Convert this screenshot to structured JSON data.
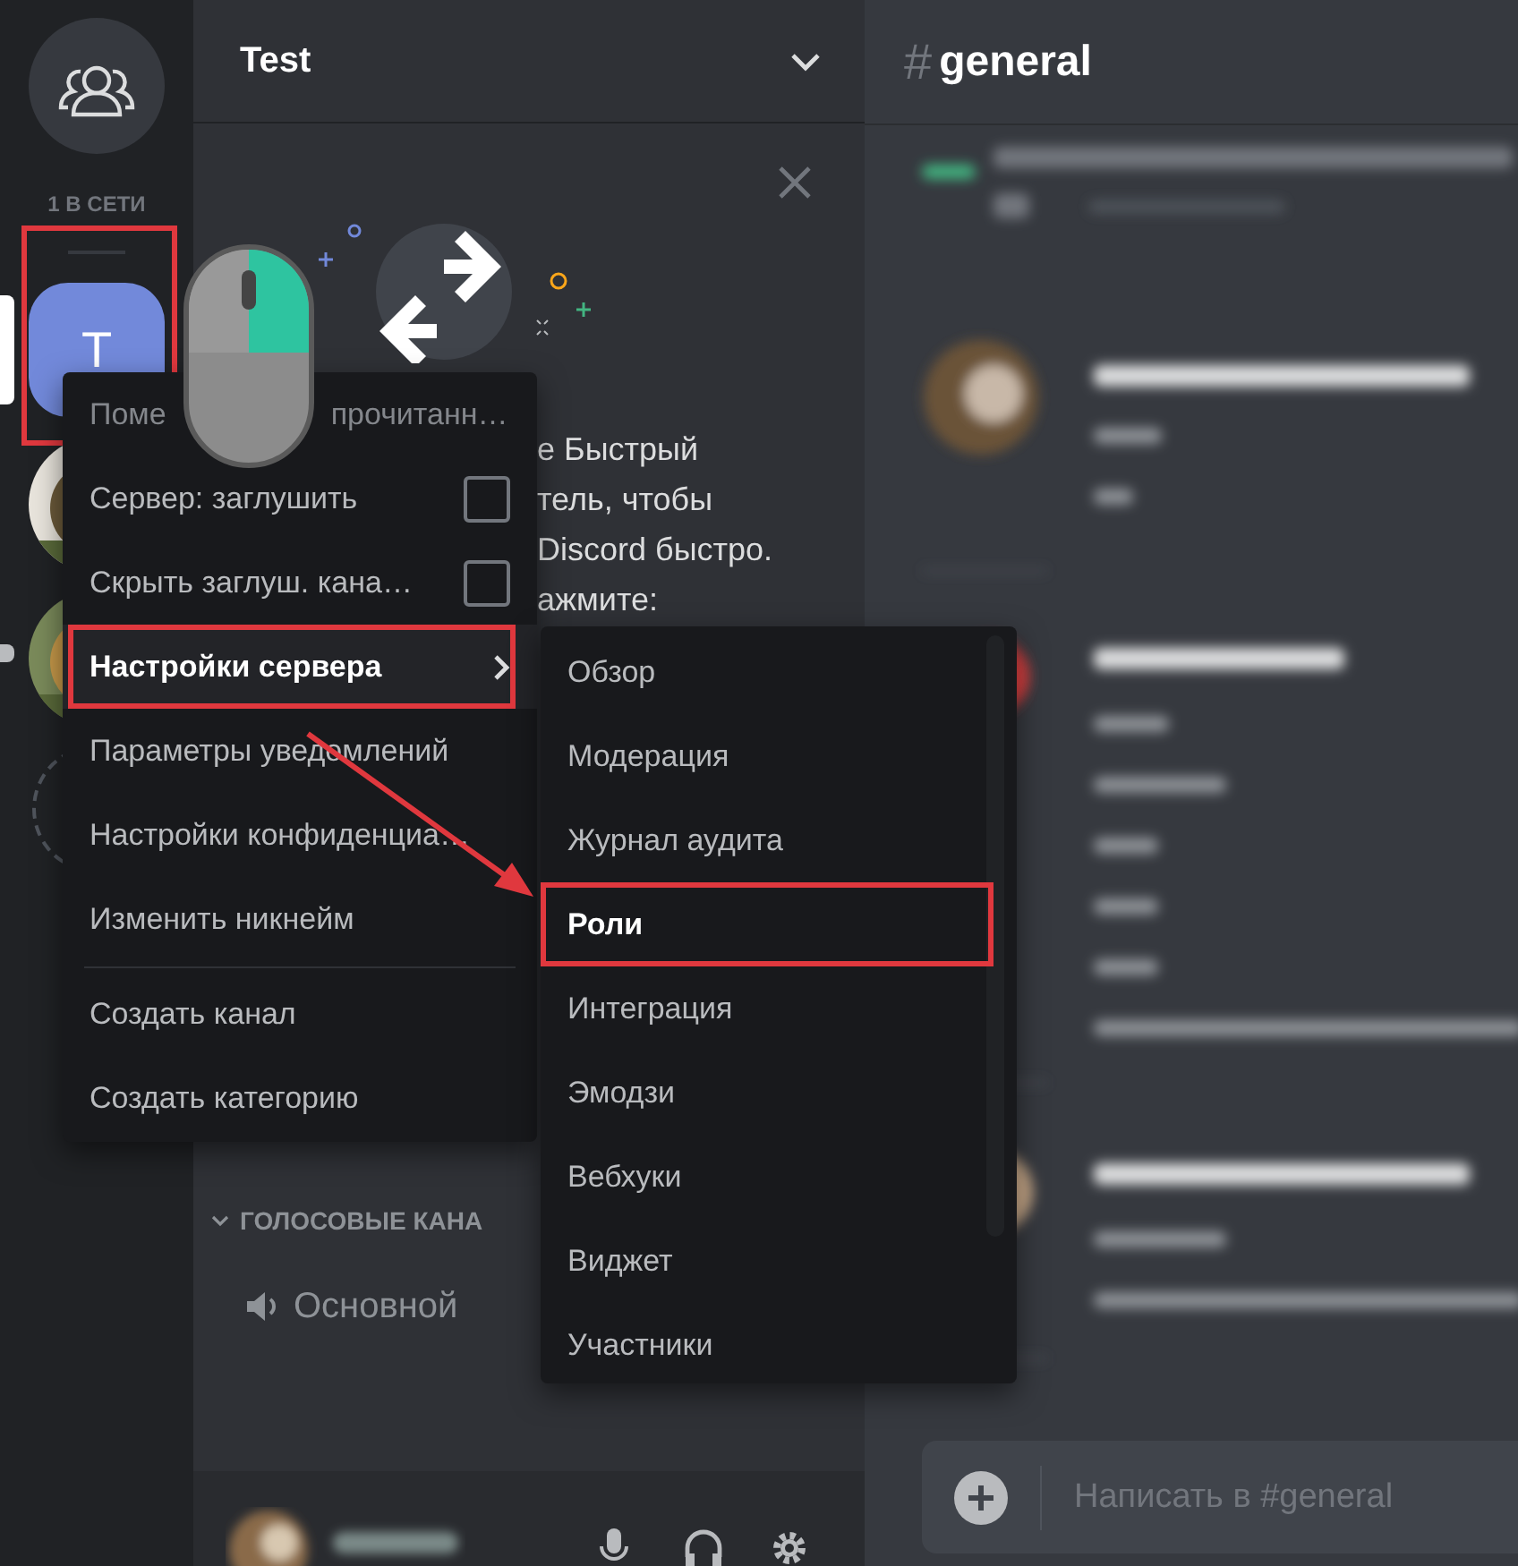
{
  "server_rail": {
    "online_label": "1 В СЕТИ",
    "servers": [
      {
        "kind": "letter",
        "label": "T",
        "selected": true,
        "unread": false,
        "annotated": true
      },
      {
        "kind": "picture",
        "selected": false,
        "unread": false,
        "annotated": false
      },
      {
        "kind": "picture",
        "selected": false,
        "unread": true,
        "annotated": false
      },
      {
        "kind": "add",
        "selected": false,
        "unread": false,
        "annotated": false
      }
    ]
  },
  "channels": {
    "server_name": "Test",
    "popup_lines": [
      "е Быстрый",
      "тель, чтобы",
      "Discord быстро.",
      "ажмите:"
    ],
    "voice_category": "ГОЛОСОВЫЕ КАНА",
    "voice_channels": [
      "Основной"
    ]
  },
  "chat": {
    "channel_prefix": "#",
    "channel": "general",
    "input_placeholder": "Написать в #general"
  },
  "context_menu": {
    "items": [
      {
        "kind": "covered",
        "label": "Поме",
        "tail": "прочитанн…",
        "selected": false,
        "disabled": true,
        "annotated": false
      },
      {
        "kind": "checkbox",
        "label": "Сервер: заглушить",
        "checked": false,
        "selected": false,
        "disabled": false,
        "annotated": false
      },
      {
        "kind": "checkbox",
        "label": "Скрыть заглуш. кана…",
        "checked": false,
        "selected": false,
        "disabled": false,
        "annotated": false
      },
      {
        "kind": "submenu",
        "label": "Настройки сервера",
        "selected": true,
        "disabled": false,
        "annotated": true
      },
      {
        "kind": "plain",
        "label": "Параметры уведомлений",
        "selected": false,
        "disabled": false,
        "annotated": false
      },
      {
        "kind": "plain",
        "label": "Настройки конфиденциа…",
        "selected": false,
        "disabled": false,
        "annotated": false
      },
      {
        "kind": "plain",
        "label": "Изменить никнейм",
        "selected": false,
        "disabled": false,
        "annotated": false
      },
      {
        "kind": "separator"
      },
      {
        "kind": "plain",
        "label": "Создать канал",
        "selected": false,
        "disabled": false,
        "annotated": false
      },
      {
        "kind": "plain",
        "label": "Создать категорию",
        "selected": false,
        "disabled": false,
        "annotated": false
      }
    ]
  },
  "submenu": {
    "items": [
      {
        "label": "Обзор",
        "selected": false,
        "annotated": false
      },
      {
        "label": "Модерация",
        "selected": false,
        "annotated": false
      },
      {
        "label": "Журнал аудита",
        "selected": false,
        "annotated": false
      },
      {
        "label": "Роли",
        "selected": true,
        "annotated": true
      },
      {
        "label": "Интеграция",
        "selected": false,
        "annotated": false
      },
      {
        "label": "Эмодзи",
        "selected": false,
        "annotated": false
      },
      {
        "label": "Вебхуки",
        "selected": false,
        "annotated": false
      },
      {
        "label": "Виджет",
        "selected": false,
        "annotated": false
      },
      {
        "label": "Участники",
        "selected": false,
        "annotated": false
      }
    ]
  }
}
